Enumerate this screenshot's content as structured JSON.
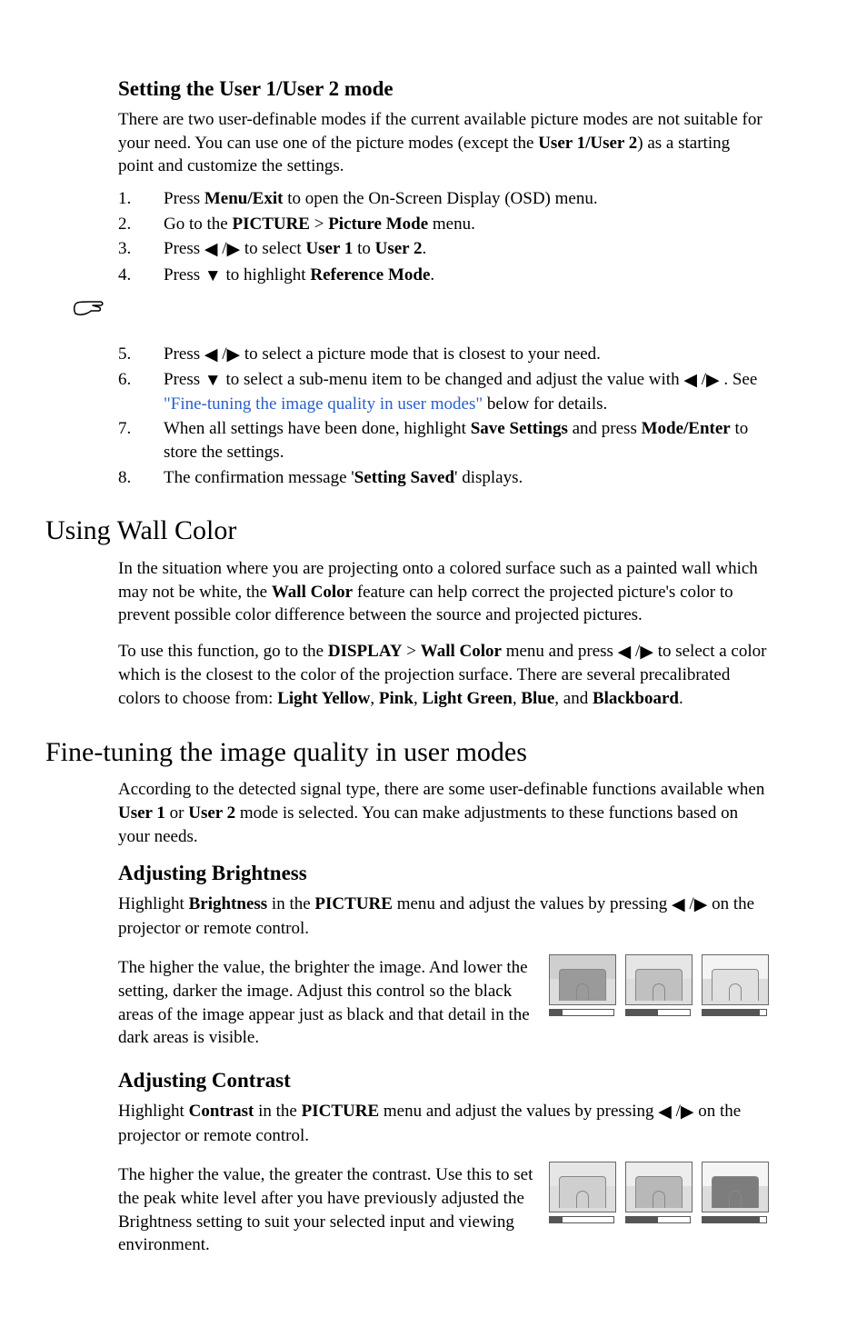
{
  "section1": {
    "heading": "Setting the User 1/User 2 mode",
    "intro_parts": [
      "There are two user-definable modes if the current available picture modes are not suitable for your need. You can use one of the picture modes (except the ",
      "User 1/User 2",
      ") as a starting point and customize the settings."
    ],
    "steps_a": [
      {
        "n": "1.",
        "parts": [
          "Press ",
          "Menu/Exit",
          " to open the On-Screen Display (OSD) menu."
        ]
      },
      {
        "n": "2.",
        "parts": [
          "Go to the ",
          "PICTURE",
          " > ",
          "Picture Mode",
          " menu."
        ]
      },
      {
        "n": "3.",
        "parts": [
          "Press ",
          "◀",
          " /",
          "▶",
          "  to select ",
          "User 1",
          " to ",
          "User 2",
          "."
        ]
      },
      {
        "n": "4.",
        "parts": [
          "Press ",
          "▼",
          "  to highlight ",
          "Reference Mode",
          "."
        ]
      }
    ],
    "steps_b": [
      {
        "n": "5.",
        "parts": [
          "Press ",
          "◀",
          " /",
          "▶",
          "  to select a picture mode that is closest to your need."
        ]
      },
      {
        "n": "6.",
        "parts": [
          "Press ",
          "▼",
          "  to select a sub-menu item to be changed and adjust the value with ",
          "◀",
          " /",
          "▶",
          " . See ",
          "\"Fine-tuning the image quality in user modes\"",
          " below for details."
        ]
      },
      {
        "n": "7.",
        "parts": [
          "When all settings have been done, highlight ",
          "Save Settings",
          " and press ",
          "Mode/Enter",
          " to store the settings."
        ]
      },
      {
        "n": "8.",
        "parts": [
          "The confirmation message '",
          "Setting Saved",
          "' displays."
        ]
      }
    ]
  },
  "section2": {
    "heading": "Using Wall Color",
    "p1_parts": [
      "In the situation where you are projecting onto a colored surface such as a painted wall which may not be white, the ",
      "Wall Color",
      " feature can help correct the projected picture's color to prevent possible color difference between the source and projected pictures."
    ],
    "p2_parts": [
      "To use this function, go to the ",
      "DISPLAY",
      " > ",
      "Wall Color",
      " menu and press ",
      "◀",
      " /",
      "▶",
      "  to select a color which is the closest to the color of the projection surface. There are several precalibrated colors to choose from: ",
      "Light Yellow",
      ", ",
      "Pink",
      ", ",
      "Light Green",
      ", ",
      "Blue",
      ", and ",
      "Blackboard",
      "."
    ]
  },
  "section3": {
    "heading": "Fine-tuning the image quality in user modes",
    "intro_parts": [
      "According to the detected signal type, there are some user-definable functions available when ",
      "User 1",
      " or ",
      "User 2",
      " mode is selected. You can make adjustments to these functions based on your needs."
    ],
    "sub1": {
      "heading": "Adjusting Brightness",
      "p1_parts": [
        "Highlight ",
        "Brightness",
        " in the ",
        "PICTURE",
        " menu and adjust the values by pressing ",
        "◀",
        " /",
        "▶",
        "  on the projector or remote control."
      ],
      "p2": "The higher the value, the brighter the image. And lower the setting, darker the image. Adjust this control so the black areas of the image appear just as black and that detail in the dark areas is visible.",
      "fills": [
        "20%",
        "50%",
        "90%"
      ]
    },
    "sub2": {
      "heading": "Adjusting Contrast",
      "p1_parts": [
        "Highlight ",
        "Contrast",
        " in the ",
        "PICTURE",
        " menu and adjust the values by pressing ",
        "◀",
        " /",
        "▶",
        "  on the projector or remote control."
      ],
      "p2": "The higher the value, the greater the contrast. Use this to set the peak white level after you have previously adjusted the Brightness setting to suit your selected input and viewing environment.",
      "fills": [
        "20%",
        "50%",
        "90%"
      ]
    }
  }
}
